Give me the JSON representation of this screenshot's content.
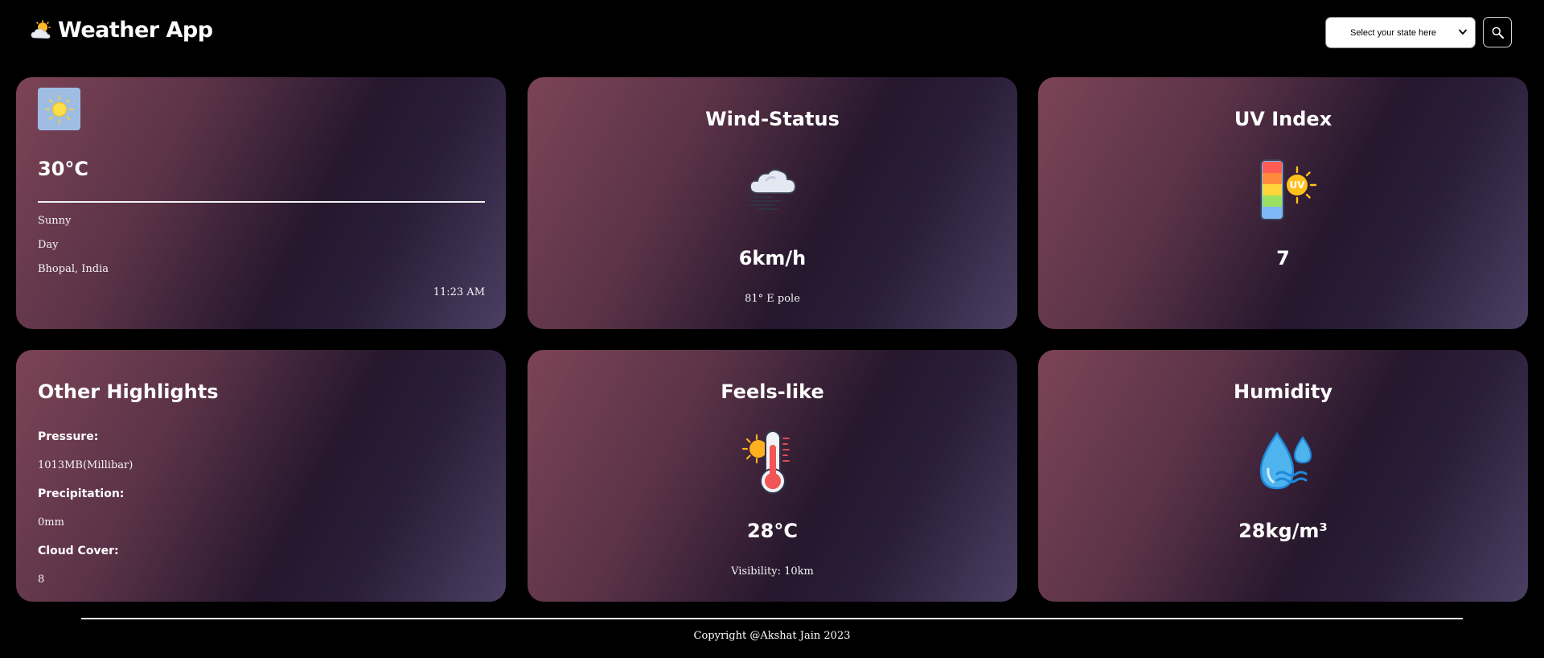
{
  "header": {
    "title": "Weather App",
    "icon": "sun-behind-cloud-icon",
    "state_select": {
      "selected": "Select your state here"
    },
    "search_icon": "search-icon"
  },
  "current": {
    "temperature": "30°C",
    "condition": "Sunny",
    "period": "Day",
    "location": "Bhopal, India",
    "time": "11:23 AM",
    "icon": "sun-icon"
  },
  "wind": {
    "title": "Wind-Status",
    "value": "6km/h",
    "direction": "81° E pole",
    "icon": "wind-cloud-icon"
  },
  "uv": {
    "title": "UV Index",
    "value": "7",
    "icon": "uv-index-icon"
  },
  "highlights": {
    "title": "Other Highlights",
    "pressure_label": "Pressure:",
    "pressure_value": "1013MB(Millibar)",
    "precipitation_label": "Precipitation:",
    "precipitation_value": "0mm",
    "cloud_label": "Cloud Cover:",
    "cloud_value": "8"
  },
  "feels": {
    "title": "Feels-like",
    "value": "28°C",
    "visibility": "Visibility: 10km",
    "icon": "thermometer-sun-icon"
  },
  "humidity": {
    "title": "Humidity",
    "value": "28kg/m³",
    "icon": "water-drops-icon"
  },
  "footer": {
    "copyright": "Copyright @Akshat Jain 2023"
  },
  "colors": {
    "background": "#000000",
    "card_gradient_start": "#7c4456",
    "card_gradient_mid": "#25172d",
    "card_gradient_end": "#4b3f62",
    "weather_tile": "#9fbde3"
  }
}
